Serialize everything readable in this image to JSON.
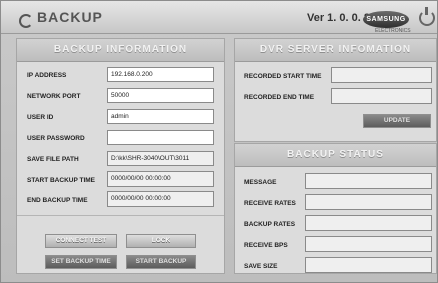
{
  "app": {
    "title": "BACKUP",
    "version": "Ver 1. 0. 0. 8",
    "brand": "SAMSUNG",
    "brand_sub": "ELECTRONICS"
  },
  "backup_info": {
    "header": "BACKUP INFORMATION",
    "fields": [
      {
        "label": "IP ADDRESS",
        "value": "192.168.0.200"
      },
      {
        "label": "NETWORK PORT",
        "value": "50000"
      },
      {
        "label": "USER ID",
        "value": "admin"
      },
      {
        "label": "USER PASSWORD",
        "value": ""
      },
      {
        "label": "SAVE FILE PATH",
        "value": "D:\\kk\\SHR-3040\\OUT\\3011"
      },
      {
        "label": "START BACKUP TIME",
        "value": "0000/00/00 00:00:00"
      },
      {
        "label": "END BACKUP TIME",
        "value": "0000/00/00 00:00:00"
      }
    ],
    "buttons": {
      "connect": "CONNECT TEST",
      "lock": "LOCK",
      "set_time": "SET BACKUP TIME",
      "start": "START BACKUP"
    }
  },
  "dvr_info": {
    "header": "DVR SERVER INFOMATION",
    "fields": [
      {
        "label": "RECORDED START TIME",
        "value": ""
      },
      {
        "label": "RECORDED END TIME",
        "value": ""
      }
    ],
    "update": "UPDATE"
  },
  "status": {
    "header": "BACKUP STATUS",
    "fields": [
      {
        "label": "MESSAGE",
        "value": ""
      },
      {
        "label": "RECEIVE RATES",
        "value": ""
      },
      {
        "label": "BACKUP RATES",
        "value": ""
      },
      {
        "label": "RECEIVE BPS",
        "value": ""
      },
      {
        "label": "SAVE SIZE",
        "value": ""
      }
    ]
  }
}
